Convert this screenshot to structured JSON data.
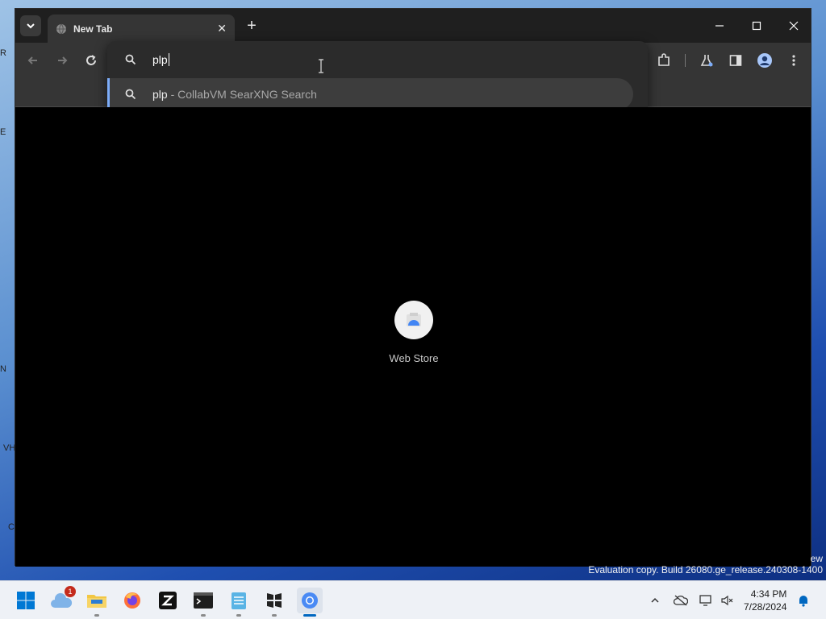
{
  "browser": {
    "tab_title": "New Tab",
    "omnibox_text": "plp",
    "suggestion": {
      "query": "plp",
      "description": " - CollabVM SearXNG Search"
    }
  },
  "content": {
    "shortcut_label": "Web Store"
  },
  "watermark": {
    "line1": "ew",
    "line2": "Evaluation copy. Build 26080.ge_release.240308-1400"
  },
  "taskbar": {
    "notification_badge": "1",
    "time": "4:34 PM",
    "date": "7/28/2024"
  },
  "desktop_slivers": [
    "R",
    "E",
    "N",
    "VH",
    "C"
  ],
  "colors": {
    "accent": "#7cacf8",
    "browser_bg": "#000000",
    "toolbar": "#353535",
    "taskbar_active": "#0067c0"
  }
}
